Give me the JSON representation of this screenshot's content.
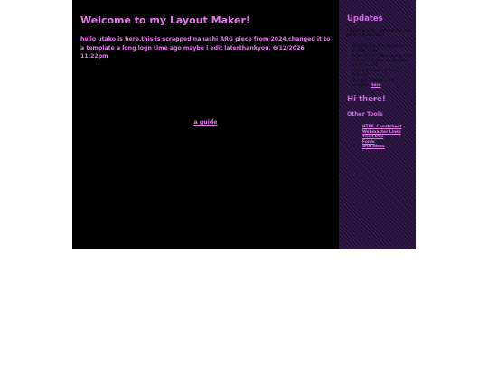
{
  "main": {
    "title": "Welcome to my Layout Maker!",
    "intro": "hello utako is here.this is scrapped nanashi ARG piece from 2024.changed it to a template a long logn time ago maybe i edit laterthankyou. 6/12/2026 11:22pm",
    "guide_link": "a guide"
  },
  "sidebar": {
    "updates_title": "Updates",
    "updated_note": "I have recently updated this tool as of August 2022!",
    "updates": [
      "Rewrote the JS to generate cleaner code",
      "Rewrote the CSS in a way that hopefully makes much more sense to edit",
      "Added a couple of new features!"
    ],
    "old_version_text": "The old version is still available",
    "old_version_link": "here",
    "hi_title": "Hi there!",
    "tools_title": "Other Tools",
    "tools": [
      "HTML Cheatsheet",
      "Webmaster Links",
      "Tiled BGs",
      "Fonts",
      "Site Ideas"
    ]
  },
  "colors": {
    "accent": "#e37be8",
    "main_bg": "#000000",
    "sidebar_bg": "#231236"
  }
}
